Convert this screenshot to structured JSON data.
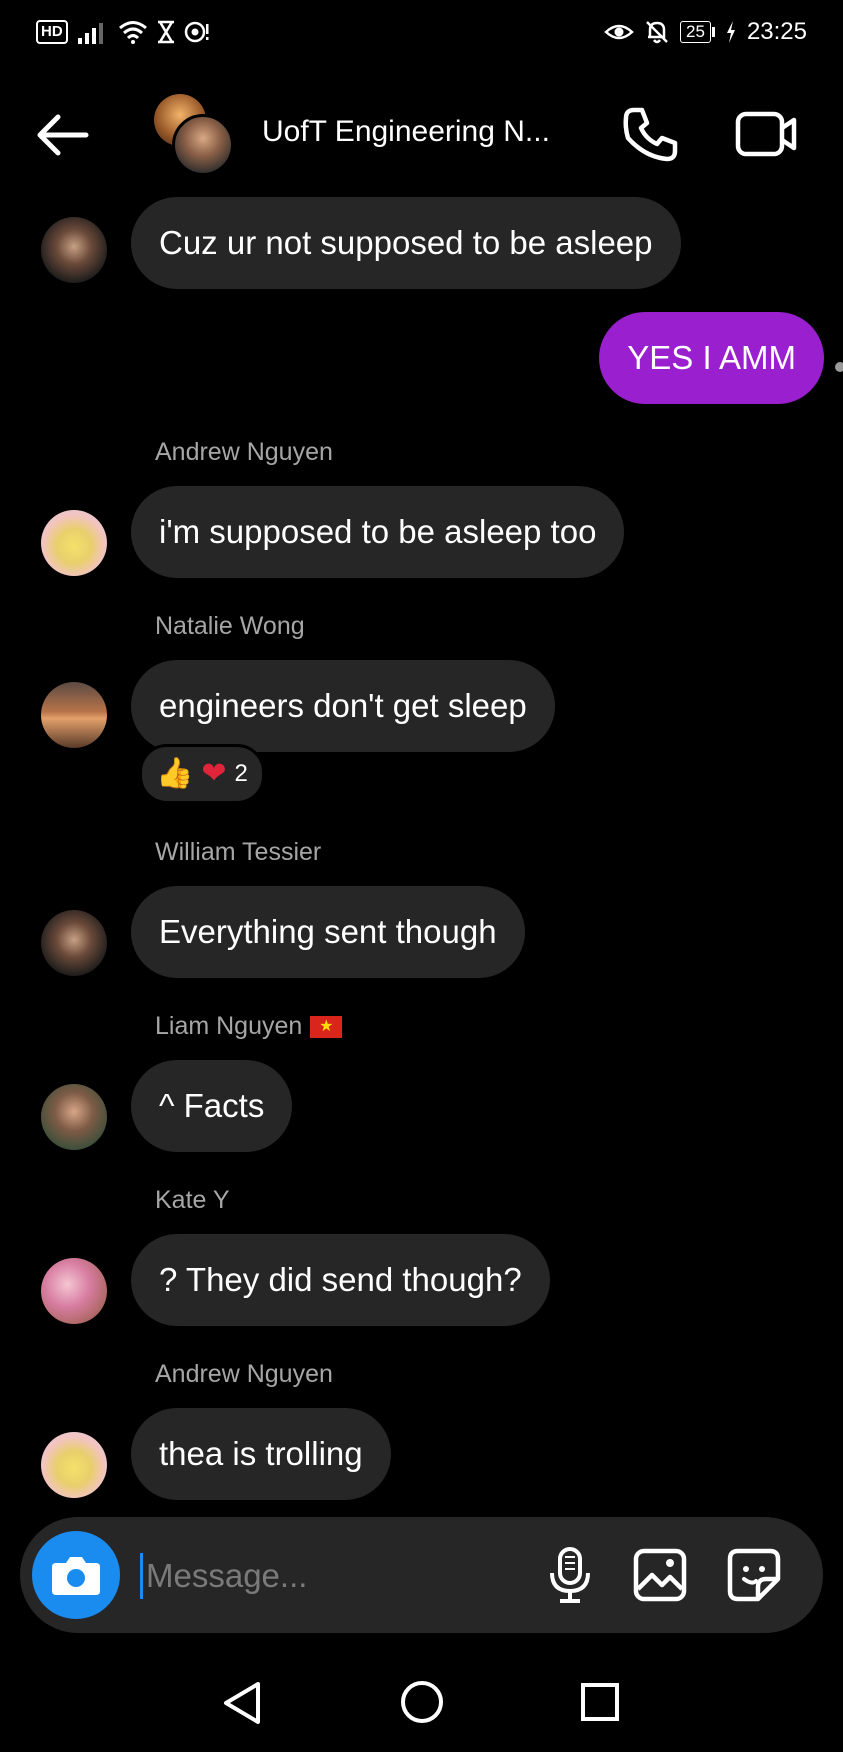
{
  "status_bar": {
    "hd": "HD",
    "battery": "25",
    "time": "23:25"
  },
  "header": {
    "title": "UofT Engineering N..."
  },
  "messages": [
    {
      "sender": "",
      "text": "Cuz ur not supposed to be asleep",
      "avatar": "william"
    },
    {
      "sender": "",
      "text": "YES I AMM",
      "mine": true
    },
    {
      "sender": "Andrew Nguyen",
      "text": "i'm supposed to be asleep too",
      "avatar": "andrew"
    },
    {
      "sender": "Natalie Wong",
      "text": "engineers don't get sleep",
      "avatar": "natalie",
      "reactions": {
        "emojis": [
          "👍",
          "❤"
        ],
        "count": "2"
      }
    },
    {
      "sender": "William Tessier",
      "text": "Everything sent though",
      "avatar": "william"
    },
    {
      "sender": "Liam Nguyen",
      "text": "^ Facts",
      "avatar": "liam",
      "flag": "★"
    },
    {
      "sender": "Kate Y",
      "text": "? They did send though?",
      "avatar": "kate"
    },
    {
      "sender": "Andrew Nguyen",
      "text": "thea is trolling",
      "avatar": "andrew"
    }
  ],
  "composer": {
    "placeholder": "Message..."
  },
  "colors": {
    "background": "#000000",
    "bubble_other": "#262626",
    "bubble_mine": "#9a1fcf",
    "accent": "#1a8cf0",
    "sender_text": "#a6a6a6"
  }
}
